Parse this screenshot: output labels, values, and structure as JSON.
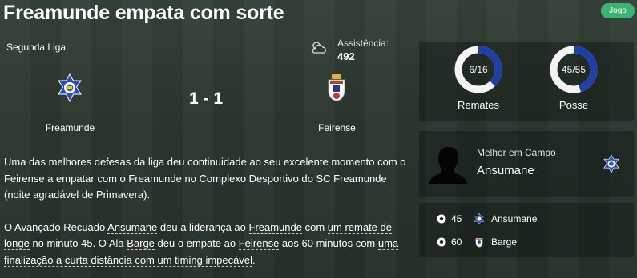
{
  "headline": "Freamunde empata com sorte",
  "badge": "Jogo",
  "match": {
    "competition": "Segunda Liga",
    "attendance_label": "Assistência:",
    "attendance_value": "492",
    "score": "1 - 1",
    "home_team": "Freamunde",
    "away_team": "Feirense",
    "weather_icon": "cloudy-icon"
  },
  "stats": {
    "shots": {
      "value": "6/16",
      "label": "Remates",
      "fraction": 0.375
    },
    "possession": {
      "value": "45/55",
      "label": "Posse",
      "fraction": 0.45
    }
  },
  "best_player": {
    "label": "Melhor em Campo",
    "name": "Ansumane"
  },
  "goals": [
    {
      "minute": "45",
      "player": "Ansumane",
      "team": "Freamunde"
    },
    {
      "minute": "60",
      "player": "Barge",
      "team": "Feirense"
    }
  ],
  "story": {
    "p1": {
      "s1": "Uma das melhores defesas da liga deu continuidade ao seu excelente momento com o ",
      "l1": "Feirense",
      "s2": " a empatar com o ",
      "l2": "Freamunde",
      "s3": " no ",
      "l3": "Complexo Desportivo do SC Freamunde",
      "s4": " (noite agradável de Primavera)."
    },
    "p2": {
      "s1": "O Avançado Recuado ",
      "l1": "Ansumane",
      "s2": " deu a liderança ao ",
      "l2": "Freamunde",
      "s3": " com ",
      "l3": "um remate de longe",
      "s4": " no minuto 45. O Ala ",
      "l4": "Barge",
      "s5": " deu o empate ao ",
      "l5": "Feirense",
      "s6": " aos 60 minutos com ",
      "l6": "uma finalização a curta distância com um timing impecável",
      "s7": "."
    }
  },
  "colors": {
    "ring_fill": "#1f3fa8",
    "ring_track": "#f4f4f4",
    "badge": "#3cb371",
    "home_crest_blue": "#2a4fb8",
    "away_crest_red": "#c0392b"
  }
}
